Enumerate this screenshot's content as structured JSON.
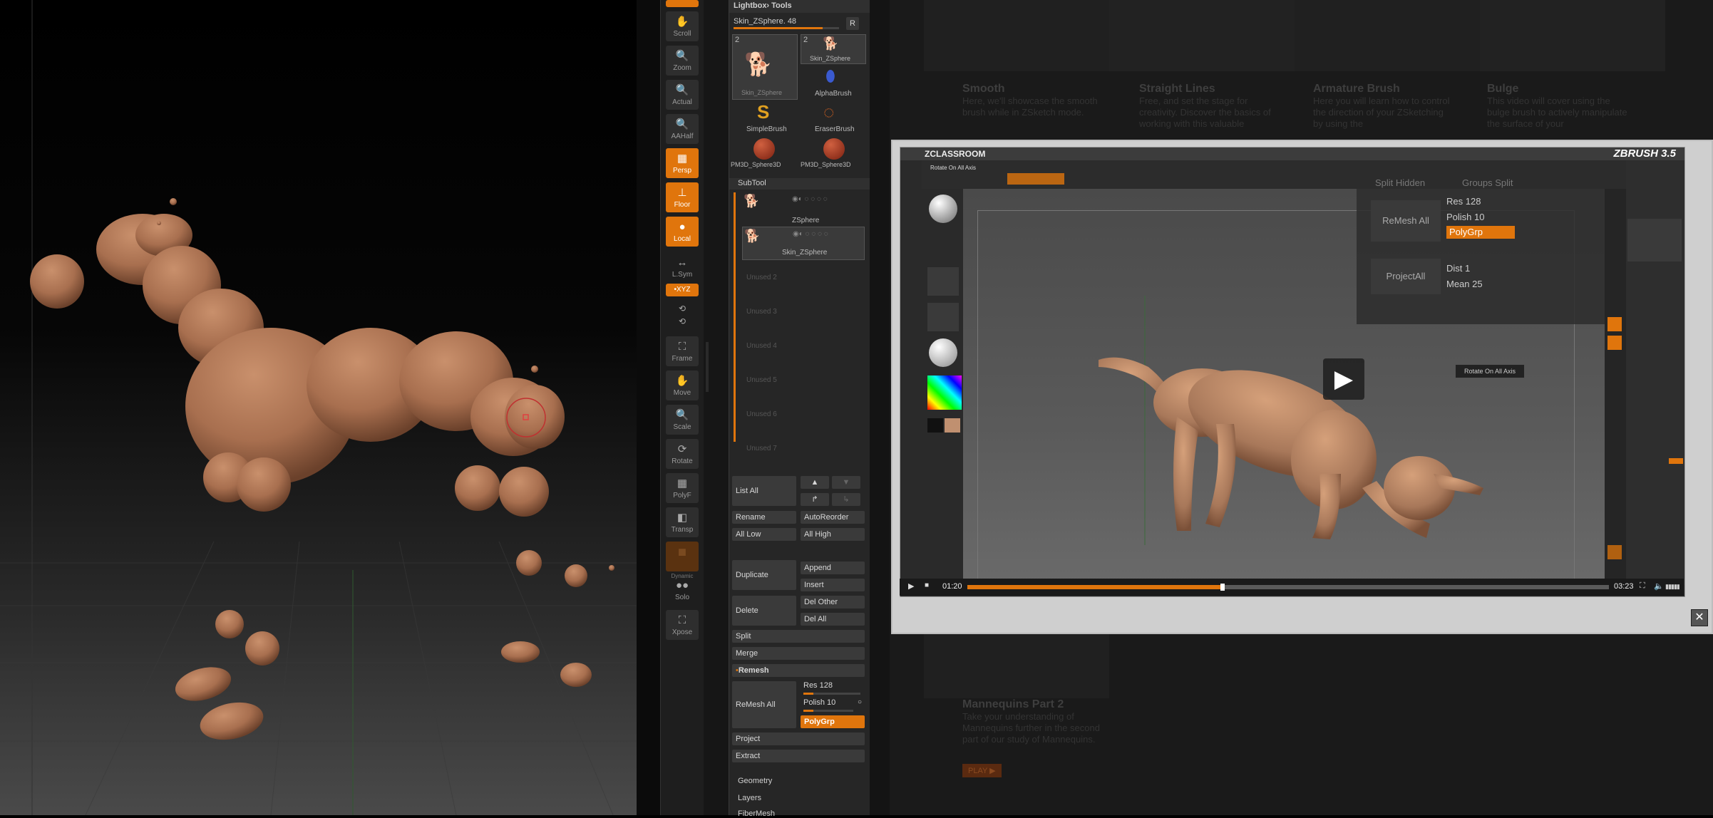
{
  "shelf": {
    "buttons": [
      {
        "label": "Scroll",
        "icon": "scroll-icon",
        "active": false
      },
      {
        "label": "Zoom",
        "icon": "zoom-icon",
        "active": false
      },
      {
        "label": "Actual",
        "icon": "actual-icon",
        "active": false
      },
      {
        "label": "AAHalf",
        "icon": "aahalf-icon",
        "active": false
      },
      {
        "label": "Persp",
        "icon": "perspective-icon",
        "active": true
      },
      {
        "label": "Floor",
        "icon": "floor-icon",
        "active": true
      },
      {
        "label": "Local",
        "icon": "local-icon",
        "active": true
      },
      {
        "label": "L.Sym",
        "icon": "local-symmetry-icon",
        "active": false
      },
      {
        "label": "Frame",
        "icon": "frame-icon",
        "active": false
      },
      {
        "label": "Move",
        "icon": "move-icon",
        "active": false
      },
      {
        "label": "Scale",
        "icon": "scale-icon",
        "active": false
      },
      {
        "label": "Rotate",
        "icon": "rotate-icon",
        "active": false
      },
      {
        "label": "PolyF",
        "icon": "polyframe-icon",
        "active": false
      },
      {
        "label": "Transp",
        "icon": "transparency-icon",
        "active": false
      },
      {
        "label": "Dynamic",
        "icon": "dynamic-icon",
        "active": false
      },
      {
        "label": "Solo",
        "icon": "solo-icon",
        "active": false
      },
      {
        "label": "Xpose",
        "icon": "xpose-icon",
        "active": false
      }
    ],
    "xyz_label": "•XYZ"
  },
  "panel": {
    "header": "Lightbox› Tools",
    "tool_name": "Skin_ZSphere. 48",
    "r_button": "R",
    "tools": [
      {
        "count": "2",
        "name": "Skin_ZSphere"
      },
      {
        "count": "2",
        "name": "Skin_ZSphere"
      },
      {
        "name": "AlphaBrush"
      },
      {
        "name": "SimpleBrush"
      },
      {
        "name": "EraserBrush"
      },
      {
        "name": "PM3D_Sphere3D"
      },
      {
        "name": "PM3D_Sphere3D"
      }
    ],
    "subtool_title": "SubTool",
    "subtools": [
      "ZSphere",
      "Skin_ZSphere"
    ],
    "unused_slots": [
      "Unused 2",
      "Unused 3",
      "Unused 4",
      "Unused 5",
      "Unused 6",
      "Unused 7"
    ],
    "list_all": "List All",
    "rename": "Rename",
    "auto_reorder": "AutoReorder",
    "all_low": "All Low",
    "all_high": "All High",
    "duplicate": "Duplicate",
    "append": "Append",
    "insert": "Insert",
    "delete": "Delete",
    "del_other": "Del Other",
    "del_all": "Del All",
    "split": "Split",
    "merge": "Merge",
    "remesh": "Remesh",
    "remesh_all": "ReMesh All",
    "res": "Res 128",
    "polish": "Polish 10",
    "polygrp": "PolyGrp",
    "project": "Project",
    "extract": "Extract",
    "geometry": "Geometry",
    "layers": "Layers",
    "fibermesh": "FiberMesh"
  },
  "website": {
    "cards": [
      {
        "title": "Smooth",
        "desc": "Here, we'll showcase the smooth brush while in ZSketch mode."
      },
      {
        "title": "Straight Lines",
        "desc": "Free, and set the stage for creativity. Discover the basics of working with this valuable"
      },
      {
        "title": "Armature Brush",
        "desc": "Here you will learn how to control the direction of your ZSketching by using the"
      },
      {
        "title": "Bulge",
        "desc": "This video will cover using the bulge brush to actively manipulate the surface of your"
      }
    ],
    "bottom_card": {
      "title": "Mannequins Part 2",
      "desc": "Take your understanding of Mannequins further in the second part of our study of Mannequins.",
      "button": "PLAY ▶"
    }
  },
  "video": {
    "brand_left": "ZCLASSROOM",
    "brand_right": "ZBRUSH 3.5",
    "inner_caption": "Rotate On All Axis",
    "tooltip": "Rotate On All Axis",
    "overlay": {
      "split_hidden": "Split Hidden",
      "groups_split": "Groups Split",
      "remesh_all": "ReMesh All",
      "res": "Res 128",
      "polish": "Polish 10",
      "polygrp": "PolyGrp",
      "project_all": "ProjectAll",
      "dist": "Dist 1",
      "mean": "Mean 25"
    },
    "time_current": "01:20",
    "time_total": "03:23",
    "progress": 0.398
  },
  "modal": {
    "close": "✕"
  },
  "colors": {
    "accent": "#e0750c",
    "clay": "#a86f4f",
    "panel": "#262626"
  }
}
